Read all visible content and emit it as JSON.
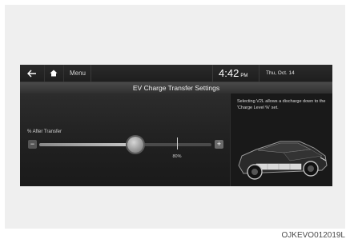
{
  "topbar": {
    "back_icon": "back-arrow-icon",
    "home_icon": "home-icon",
    "menu_label": "Menu",
    "time": "4:42",
    "ampm": "PM",
    "date": "Thu, Oct. 14"
  },
  "title": "EV Charge Transfer Settings",
  "slider": {
    "label": "% After Transfer",
    "minus_label": "−",
    "plus_label": "+",
    "value_percent": 56,
    "marker_percent": 80,
    "marker_label": "80%"
  },
  "info": {
    "text": "Selecting V2L allows a discharge down to the 'Charge Level %' set."
  },
  "car_icon": "ev-car-illustration",
  "caption": "OJKEVO012019L",
  "colors": {
    "screen_bg": "#1b1b1b",
    "text": "#dcdcdc"
  }
}
